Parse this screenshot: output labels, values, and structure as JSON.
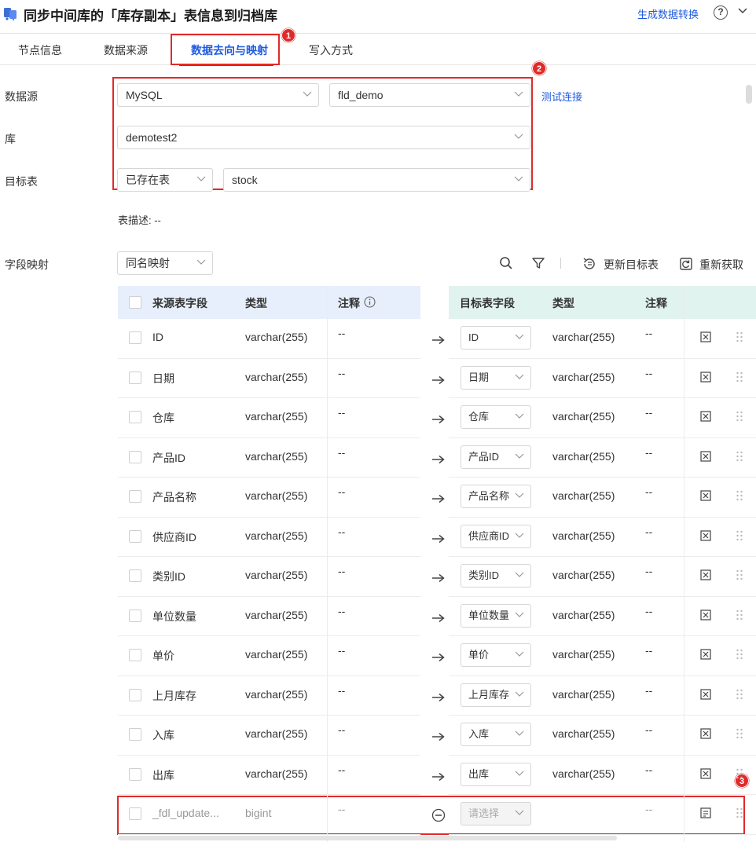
{
  "header": {
    "title": "同步中间库的「库存副本」表信息到归档库",
    "generate_link": "生成数据转换",
    "help_glyph": "?"
  },
  "tabs": [
    "节点信息",
    "数据来源",
    "数据去向与映射",
    "写入方式"
  ],
  "active_tab_index": 2,
  "badges": [
    "1",
    "2",
    "3"
  ],
  "form": {
    "datasource_label": "数据源",
    "datasource_type": "MySQL",
    "datasource_conn": "fld_demo",
    "test_connection": "测试连接",
    "db_label": "库",
    "db_value": "demotest2",
    "target_label": "目标表",
    "target_mode": "已存在表",
    "target_table": "stock",
    "table_desc": "表描述: --"
  },
  "mapping": {
    "label": "字段映射",
    "mode": "同名映射",
    "refresh_target": "更新目标表",
    "reload": "重新获取"
  },
  "source_headers": [
    "来源表字段",
    "类型",
    "注释"
  ],
  "target_headers": [
    "目标表字段",
    "类型",
    "注释"
  ],
  "rows": [
    {
      "src": "ID",
      "src_type": "varchar(255)",
      "src_comment": "--",
      "tgt": "ID",
      "tgt_type": "varchar(255)",
      "tgt_comment": "--"
    },
    {
      "src": "日期",
      "src_type": "varchar(255)",
      "src_comment": "--",
      "tgt": "日期",
      "tgt_type": "varchar(255)",
      "tgt_comment": "--"
    },
    {
      "src": "仓库",
      "src_type": "varchar(255)",
      "src_comment": "--",
      "tgt": "仓库",
      "tgt_type": "varchar(255)",
      "tgt_comment": "--"
    },
    {
      "src": "产品ID",
      "src_type": "varchar(255)",
      "src_comment": "--",
      "tgt": "产品ID",
      "tgt_type": "varchar(255)",
      "tgt_comment": "--"
    },
    {
      "src": "产品名称",
      "src_type": "varchar(255)",
      "src_comment": "--",
      "tgt": "产品名称",
      "tgt_type": "varchar(255)",
      "tgt_comment": "--"
    },
    {
      "src": "供应商ID",
      "src_type": "varchar(255)",
      "src_comment": "--",
      "tgt": "供应商ID",
      "tgt_type": "varchar(255)",
      "tgt_comment": "--"
    },
    {
      "src": "类别ID",
      "src_type": "varchar(255)",
      "src_comment": "--",
      "tgt": "类别ID",
      "tgt_type": "varchar(255)",
      "tgt_comment": "--"
    },
    {
      "src": "单位数量",
      "src_type": "varchar(255)",
      "src_comment": "--",
      "tgt": "单位数量",
      "tgt_type": "varchar(255)",
      "tgt_comment": "--"
    },
    {
      "src": "单价",
      "src_type": "varchar(255)",
      "src_comment": "--",
      "tgt": "单价",
      "tgt_type": "varchar(255)",
      "tgt_comment": "--"
    },
    {
      "src": "上月库存",
      "src_type": "varchar(255)",
      "src_comment": "--",
      "tgt": "上月库存",
      "tgt_type": "varchar(255)",
      "tgt_comment": "--"
    },
    {
      "src": "入库",
      "src_type": "varchar(255)",
      "src_comment": "--",
      "tgt": "入库",
      "tgt_type": "varchar(255)",
      "tgt_comment": "--"
    },
    {
      "src": "出库",
      "src_type": "varchar(255)",
      "src_comment": "--",
      "tgt": "出库",
      "tgt_type": "varchar(255)",
      "tgt_comment": "--"
    },
    {
      "src": "_fdl_update...",
      "src_type": "bigint",
      "src_comment": "--",
      "tgt": "请选择",
      "tgt_type": "",
      "tgt_comment": "--",
      "unmapped": true
    }
  ],
  "colors": {
    "accent": "#1f5ae0",
    "annotation": "#e02a2a",
    "source_header_bg": "#e6effb",
    "target_header_bg": "#e1f3ee"
  }
}
